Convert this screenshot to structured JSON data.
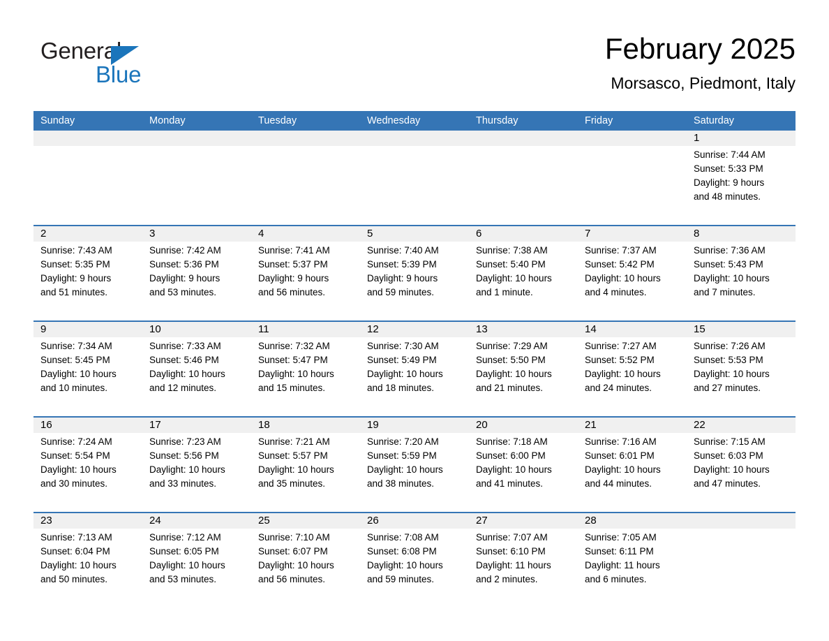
{
  "brand": {
    "name_part1": "General",
    "name_part2": "Blue",
    "accent_color": "#1b75bb"
  },
  "header": {
    "title": "February 2025",
    "subtitle": "Morsasco, Piedmont, Italy"
  },
  "theme": {
    "header_band": "#3575b5",
    "day_band": "#f0f0f0",
    "text": "#000000"
  },
  "weekdays": [
    "Sunday",
    "Monday",
    "Tuesday",
    "Wednesday",
    "Thursday",
    "Friday",
    "Saturday"
  ],
  "weeks": [
    [
      {
        "date": "",
        "empty": true,
        "sunrise": "",
        "sunset": "",
        "daylight_line1": "",
        "daylight_line2": ""
      },
      {
        "date": "",
        "empty": true,
        "sunrise": "",
        "sunset": "",
        "daylight_line1": "",
        "daylight_line2": ""
      },
      {
        "date": "",
        "empty": true,
        "sunrise": "",
        "sunset": "",
        "daylight_line1": "",
        "daylight_line2": ""
      },
      {
        "date": "",
        "empty": true,
        "sunrise": "",
        "sunset": "",
        "daylight_line1": "",
        "daylight_line2": ""
      },
      {
        "date": "",
        "empty": true,
        "sunrise": "",
        "sunset": "",
        "daylight_line1": "",
        "daylight_line2": ""
      },
      {
        "date": "",
        "empty": true,
        "sunrise": "",
        "sunset": "",
        "daylight_line1": "",
        "daylight_line2": ""
      },
      {
        "date": "1",
        "empty": false,
        "sunrise": "Sunrise: 7:44 AM",
        "sunset": "Sunset: 5:33 PM",
        "daylight_line1": "Daylight: 9 hours",
        "daylight_line2": "and 48 minutes."
      }
    ],
    [
      {
        "date": "2",
        "empty": false,
        "sunrise": "Sunrise: 7:43 AM",
        "sunset": "Sunset: 5:35 PM",
        "daylight_line1": "Daylight: 9 hours",
        "daylight_line2": "and 51 minutes."
      },
      {
        "date": "3",
        "empty": false,
        "sunrise": "Sunrise: 7:42 AM",
        "sunset": "Sunset: 5:36 PM",
        "daylight_line1": "Daylight: 9 hours",
        "daylight_line2": "and 53 minutes."
      },
      {
        "date": "4",
        "empty": false,
        "sunrise": "Sunrise: 7:41 AM",
        "sunset": "Sunset: 5:37 PM",
        "daylight_line1": "Daylight: 9 hours",
        "daylight_line2": "and 56 minutes."
      },
      {
        "date": "5",
        "empty": false,
        "sunrise": "Sunrise: 7:40 AM",
        "sunset": "Sunset: 5:39 PM",
        "daylight_line1": "Daylight: 9 hours",
        "daylight_line2": "and 59 minutes."
      },
      {
        "date": "6",
        "empty": false,
        "sunrise": "Sunrise: 7:38 AM",
        "sunset": "Sunset: 5:40 PM",
        "daylight_line1": "Daylight: 10 hours",
        "daylight_line2": "and 1 minute."
      },
      {
        "date": "7",
        "empty": false,
        "sunrise": "Sunrise: 7:37 AM",
        "sunset": "Sunset: 5:42 PM",
        "daylight_line1": "Daylight: 10 hours",
        "daylight_line2": "and 4 minutes."
      },
      {
        "date": "8",
        "empty": false,
        "sunrise": "Sunrise: 7:36 AM",
        "sunset": "Sunset: 5:43 PM",
        "daylight_line1": "Daylight: 10 hours",
        "daylight_line2": "and 7 minutes."
      }
    ],
    [
      {
        "date": "9",
        "empty": false,
        "sunrise": "Sunrise: 7:34 AM",
        "sunset": "Sunset: 5:45 PM",
        "daylight_line1": "Daylight: 10 hours",
        "daylight_line2": "and 10 minutes."
      },
      {
        "date": "10",
        "empty": false,
        "sunrise": "Sunrise: 7:33 AM",
        "sunset": "Sunset: 5:46 PM",
        "daylight_line1": "Daylight: 10 hours",
        "daylight_line2": "and 12 minutes."
      },
      {
        "date": "11",
        "empty": false,
        "sunrise": "Sunrise: 7:32 AM",
        "sunset": "Sunset: 5:47 PM",
        "daylight_line1": "Daylight: 10 hours",
        "daylight_line2": "and 15 minutes."
      },
      {
        "date": "12",
        "empty": false,
        "sunrise": "Sunrise: 7:30 AM",
        "sunset": "Sunset: 5:49 PM",
        "daylight_line1": "Daylight: 10 hours",
        "daylight_line2": "and 18 minutes."
      },
      {
        "date": "13",
        "empty": false,
        "sunrise": "Sunrise: 7:29 AM",
        "sunset": "Sunset: 5:50 PM",
        "daylight_line1": "Daylight: 10 hours",
        "daylight_line2": "and 21 minutes."
      },
      {
        "date": "14",
        "empty": false,
        "sunrise": "Sunrise: 7:27 AM",
        "sunset": "Sunset: 5:52 PM",
        "daylight_line1": "Daylight: 10 hours",
        "daylight_line2": "and 24 minutes."
      },
      {
        "date": "15",
        "empty": false,
        "sunrise": "Sunrise: 7:26 AM",
        "sunset": "Sunset: 5:53 PM",
        "daylight_line1": "Daylight: 10 hours",
        "daylight_line2": "and 27 minutes."
      }
    ],
    [
      {
        "date": "16",
        "empty": false,
        "sunrise": "Sunrise: 7:24 AM",
        "sunset": "Sunset: 5:54 PM",
        "daylight_line1": "Daylight: 10 hours",
        "daylight_line2": "and 30 minutes."
      },
      {
        "date": "17",
        "empty": false,
        "sunrise": "Sunrise: 7:23 AM",
        "sunset": "Sunset: 5:56 PM",
        "daylight_line1": "Daylight: 10 hours",
        "daylight_line2": "and 33 minutes."
      },
      {
        "date": "18",
        "empty": false,
        "sunrise": "Sunrise: 7:21 AM",
        "sunset": "Sunset: 5:57 PM",
        "daylight_line1": "Daylight: 10 hours",
        "daylight_line2": "and 35 minutes."
      },
      {
        "date": "19",
        "empty": false,
        "sunrise": "Sunrise: 7:20 AM",
        "sunset": "Sunset: 5:59 PM",
        "daylight_line1": "Daylight: 10 hours",
        "daylight_line2": "and 38 minutes."
      },
      {
        "date": "20",
        "empty": false,
        "sunrise": "Sunrise: 7:18 AM",
        "sunset": "Sunset: 6:00 PM",
        "daylight_line1": "Daylight: 10 hours",
        "daylight_line2": "and 41 minutes."
      },
      {
        "date": "21",
        "empty": false,
        "sunrise": "Sunrise: 7:16 AM",
        "sunset": "Sunset: 6:01 PM",
        "daylight_line1": "Daylight: 10 hours",
        "daylight_line2": "and 44 minutes."
      },
      {
        "date": "22",
        "empty": false,
        "sunrise": "Sunrise: 7:15 AM",
        "sunset": "Sunset: 6:03 PM",
        "daylight_line1": "Daylight: 10 hours",
        "daylight_line2": "and 47 minutes."
      }
    ],
    [
      {
        "date": "23",
        "empty": false,
        "sunrise": "Sunrise: 7:13 AM",
        "sunset": "Sunset: 6:04 PM",
        "daylight_line1": "Daylight: 10 hours",
        "daylight_line2": "and 50 minutes."
      },
      {
        "date": "24",
        "empty": false,
        "sunrise": "Sunrise: 7:12 AM",
        "sunset": "Sunset: 6:05 PM",
        "daylight_line1": "Daylight: 10 hours",
        "daylight_line2": "and 53 minutes."
      },
      {
        "date": "25",
        "empty": false,
        "sunrise": "Sunrise: 7:10 AM",
        "sunset": "Sunset: 6:07 PM",
        "daylight_line1": "Daylight: 10 hours",
        "daylight_line2": "and 56 minutes."
      },
      {
        "date": "26",
        "empty": false,
        "sunrise": "Sunrise: 7:08 AM",
        "sunset": "Sunset: 6:08 PM",
        "daylight_line1": "Daylight: 10 hours",
        "daylight_line2": "and 59 minutes."
      },
      {
        "date": "27",
        "empty": false,
        "sunrise": "Sunrise: 7:07 AM",
        "sunset": "Sunset: 6:10 PM",
        "daylight_line1": "Daylight: 11 hours",
        "daylight_line2": "and 2 minutes."
      },
      {
        "date": "28",
        "empty": false,
        "sunrise": "Sunrise: 7:05 AM",
        "sunset": "Sunset: 6:11 PM",
        "daylight_line1": "Daylight: 11 hours",
        "daylight_line2": "and 6 minutes."
      },
      {
        "date": "",
        "empty": true,
        "sunrise": "",
        "sunset": "",
        "daylight_line1": "",
        "daylight_line2": ""
      }
    ]
  ]
}
